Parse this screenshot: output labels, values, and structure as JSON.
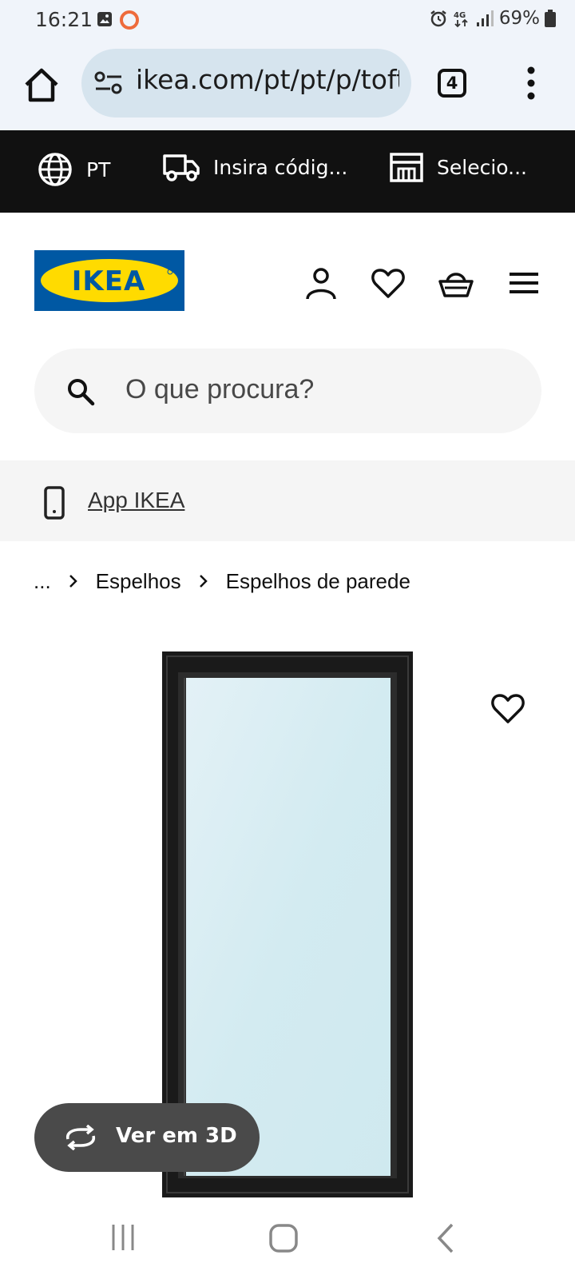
{
  "status_bar": {
    "time": "16:21",
    "battery": "69%"
  },
  "browser": {
    "url": "ikea.com/pt/pt/p/toftbyn",
    "tab_count": "4"
  },
  "top_strip": {
    "language": "PT",
    "postal_code": "Insira códig...",
    "store": "Selecio..."
  },
  "brand": {
    "logo_text": "IKEA",
    "logo_blue": "#0058a3",
    "logo_yellow": "#ffdb00"
  },
  "search": {
    "placeholder": "O que procura?"
  },
  "app_banner": {
    "label": "App IKEA"
  },
  "breadcrumb": {
    "ellipsis": "...",
    "items": [
      "Espelhos",
      "Espelhos de parede"
    ]
  },
  "product": {
    "view_3d_label": "Ver em 3D"
  },
  "colors": {
    "strip_bg": "#111111",
    "mirror_glass": "#d8eef3",
    "frame": "#1e1e1e"
  }
}
